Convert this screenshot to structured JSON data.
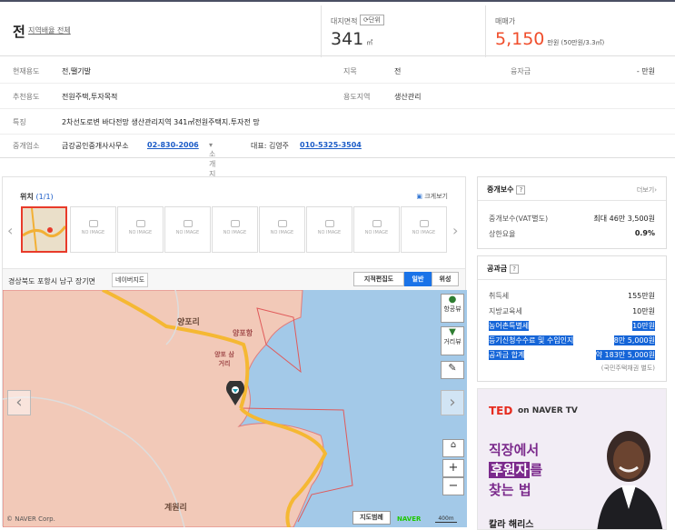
{
  "header": {
    "title": "전",
    "title_link": "지역배율 전체",
    "area_label": "대지면적",
    "unit_button": "단위",
    "area_value": "341",
    "area_unit": "㎡",
    "price_label": "매매가",
    "price_value": "5,150",
    "price_unit": "만원 (50만원/3.3㎡)"
  },
  "info": {
    "row1": {
      "k1": "현재용도",
      "v1": "전,땔기발",
      "k2": "지목",
      "v2": "전",
      "k3": "융자금",
      "v3": "- 만원"
    },
    "row2": {
      "k1": "추천용도",
      "v1": "전원주택,투자목적",
      "k2": "용도지역",
      "v2": "생산관리"
    },
    "row3": {
      "k1": "특징",
      "v1": "2차선도로변 바다전망 생산관리지역 341㎡전원주택지.투자전 망"
    },
    "row4": {
      "k1": "중개업소",
      "office": "금강공인중개사사무소",
      "phone": "02-830-2006",
      "intro": "소개지",
      "rep": "대표: 김영주",
      "mobile": "010-5325-3504"
    }
  },
  "location": {
    "title": "위치",
    "count": "(1/1)",
    "enlarge": "크게보기",
    "no_image": "NO IMAGE",
    "address": "경상북도 포항시 남구 장기면",
    "naver_map": "네이버지도"
  },
  "map": {
    "btn_cadastral": "지적편집도",
    "btn_normal": "일반",
    "btn_satellite": "위성",
    "aerial": "항공뷰",
    "street": "거리뷰",
    "zoom_in": "+",
    "zoom_out": "−",
    "legend": "지도범례",
    "scale": "400m",
    "brand": "NAVER",
    "copyright": "© NAVER Corp.",
    "labels": {
      "l1": "양포리",
      "l2": "양포항",
      "l3": "양포 삼거리",
      "l4": "계원리"
    }
  },
  "brokerage": {
    "title": "중개보수",
    "q": "?",
    "more": "더보기",
    "rows": [
      {
        "k": "중개보수(VAT별도)",
        "v": "최대 46만 3,500원"
      },
      {
        "k": "상한요율",
        "v": "0.9%"
      }
    ]
  },
  "tax": {
    "title": "공과금",
    "q": "?",
    "rows": [
      {
        "k": "취득세",
        "v": "155만원"
      },
      {
        "k": "지방교육세",
        "v": "10만원"
      },
      {
        "k": "농어촌특별세",
        "v": "10만원"
      },
      {
        "k": "등기신청수수료 및 수입인지",
        "v": "8만 5,000원"
      },
      {
        "k": "공과금 합계",
        "v": "약 183만 5,000원"
      }
    ],
    "note": "(국민주택채권 별도)"
  },
  "ad": {
    "brand": "TED",
    "brand_rest": "on NAVER TV",
    "l1": "직장에서",
    "l2": "후원자",
    "l2b": "를",
    "l3": "찾는 법",
    "name": "칼라 해리스"
  }
}
